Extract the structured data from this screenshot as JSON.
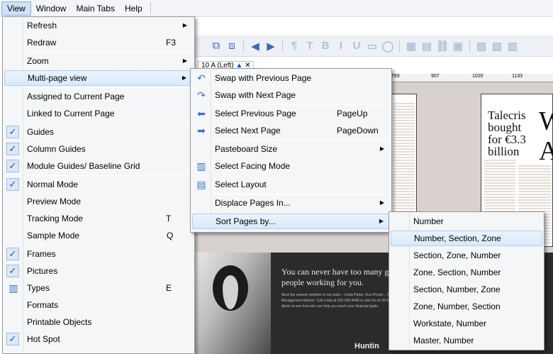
{
  "menubar": {
    "items": [
      "View",
      "Window",
      "Main Tabs",
      "Help"
    ]
  },
  "page_tab": {
    "label": "10 A (Left)"
  },
  "ruler": {
    "ticks": [
      "793",
      "907",
      "1020",
      "1133"
    ]
  },
  "document": {
    "headline": [
      "Talecris",
      "bought",
      "for €3.3",
      "billion"
    ],
    "big_letters": [
      "W",
      "A"
    ],
    "ad_headline": "You can never have too many great people working for you.",
    "ad_body": "Meet the newest member of our team – Linda Parks, Vice Presid... Wealth Management Advisor. Call Linda at 330-258-4440 or visit her at 39 E. Market Street in Akron to see how she can help you reach your financial goals.",
    "ad_logo": "Huntin"
  },
  "view_menu": {
    "items": [
      {
        "label": "Refresh",
        "arrow": "▶"
      },
      {
        "label": "Redraw",
        "shortcut": "F3"
      },
      {
        "label": "Zoom",
        "arrow": "▶"
      },
      {
        "label": "Multi-page view",
        "arrow": "▶"
      },
      {
        "label": "Assigned to Current Page"
      },
      {
        "label": "Linked to Current Page"
      },
      {
        "label": "Guides",
        "check": "✓"
      },
      {
        "label": "Column Guides",
        "check": "✓"
      },
      {
        "label": "Module Guides/ Baseline Grid",
        "check": "✓"
      },
      {
        "label": "Normal Mode",
        "check": "✓"
      },
      {
        "label": "Preview Mode"
      },
      {
        "label": "Tracking Mode",
        "shortcut": "T"
      },
      {
        "label": "Sample Mode",
        "shortcut": "Q"
      },
      {
        "label": "Frames",
        "check": "✓"
      },
      {
        "label": "Pictures",
        "check": "✓"
      },
      {
        "label": "Types",
        "shortcut": "E"
      },
      {
        "label": "Formats"
      },
      {
        "label": "Printable Objects"
      },
      {
        "label": "Hot Spot",
        "check": "✓"
      }
    ]
  },
  "multipage_menu": {
    "items": [
      {
        "label": "Swap with Previous Page"
      },
      {
        "label": "Swap with Next Page"
      },
      {
        "label": "Select Previous Page",
        "shortcut": "PageUp"
      },
      {
        "label": "Select Next Page",
        "shortcut": "PageDown"
      },
      {
        "label": "Pasteboard Size",
        "arrow": "▶"
      },
      {
        "label": "Select Facing Mode"
      },
      {
        "label": "Select Layout"
      },
      {
        "label": "Displace Pages In...",
        "arrow": "▶"
      },
      {
        "label": "Sort Pages by...",
        "arrow": "▶"
      }
    ]
  },
  "sort_menu": {
    "items": [
      "Number",
      "Number, Section, Zone",
      "Section, Zone, Number",
      "Zone, Section, Number",
      "Section, Number, Zone",
      "Zone, Number, Section",
      "Workstate, Number",
      "Master, Number"
    ]
  },
  "colors": {
    "highlight": "#d9e9fb",
    "highlight_border": "#aecff7",
    "menu_bg": "#f5f6f7"
  }
}
